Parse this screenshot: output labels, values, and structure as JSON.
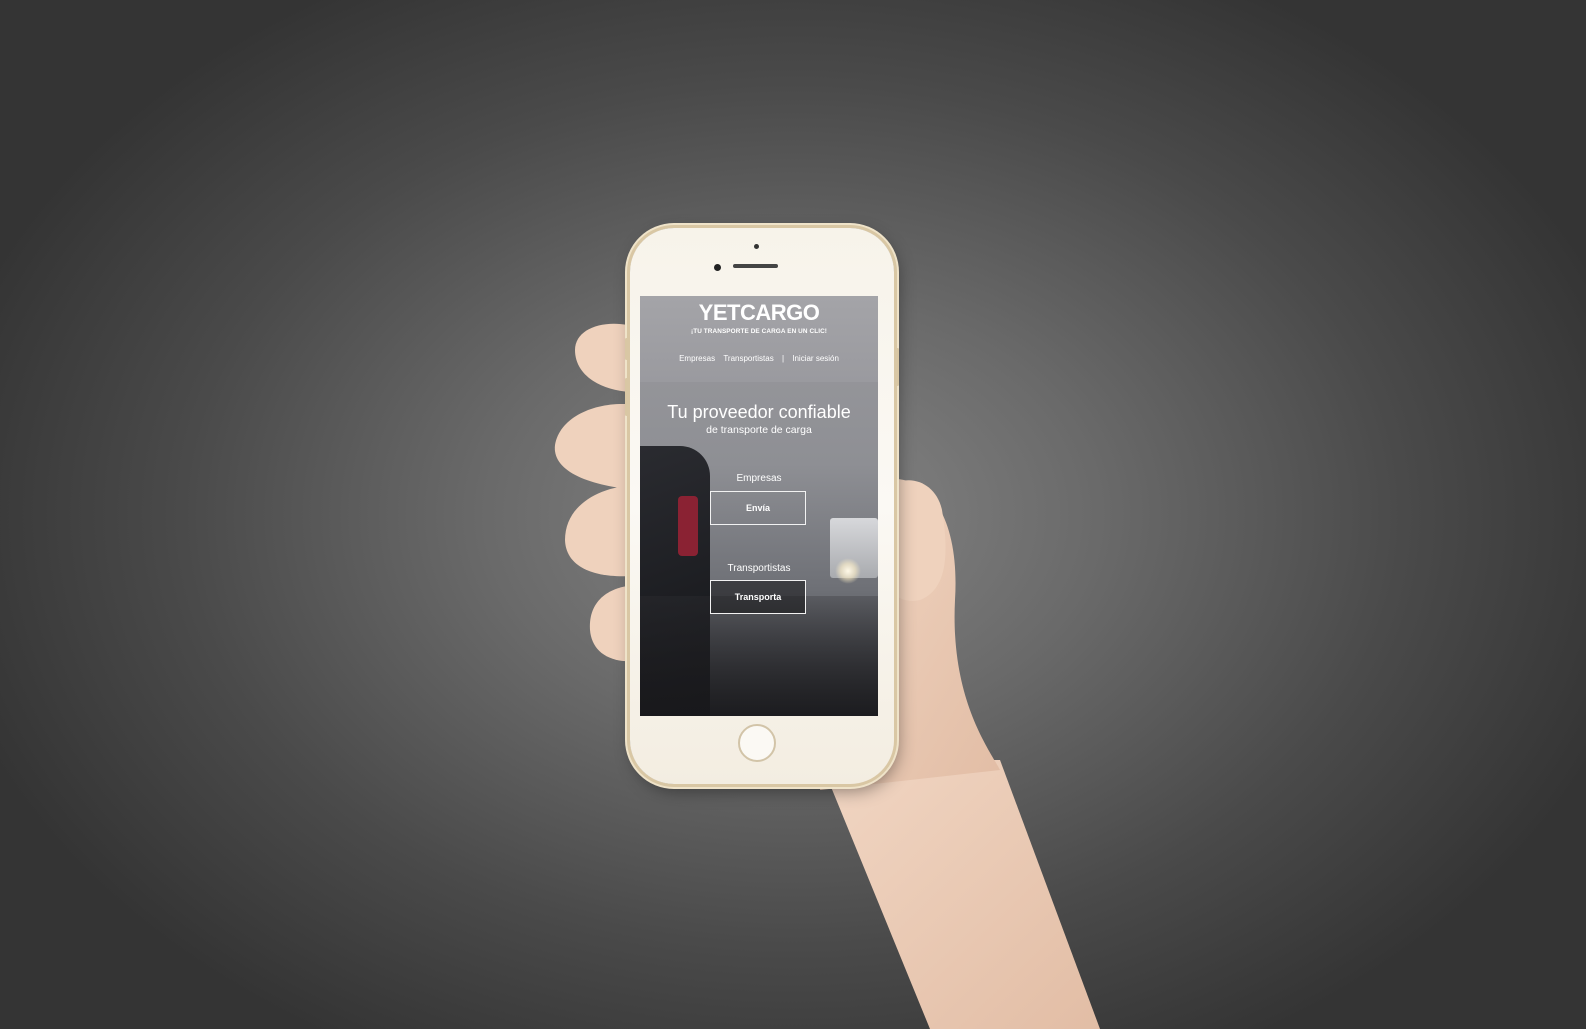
{
  "app": {
    "logo_text": "YETCARGO",
    "tagline": "¡TU TRANSPORTE DE CARGA EN UN CLIC!"
  },
  "nav": {
    "items": [
      "Empresas",
      "Transportistas"
    ],
    "separator": "|",
    "login": "Iniciar sesión"
  },
  "hero": {
    "title": "Tu proveedor confiable",
    "subtitle": "de transporte de carga"
  },
  "sections": {
    "companies": {
      "label": "Empresas",
      "button": "Envía"
    },
    "carriers": {
      "label": "Transportistas",
      "button": "Transporta"
    }
  },
  "colors": {
    "background": "#4a4a4a",
    "phone_frame": "#f7f3ea",
    "accent_gold": "#d9c7a4",
    "text": "#ffffff"
  }
}
